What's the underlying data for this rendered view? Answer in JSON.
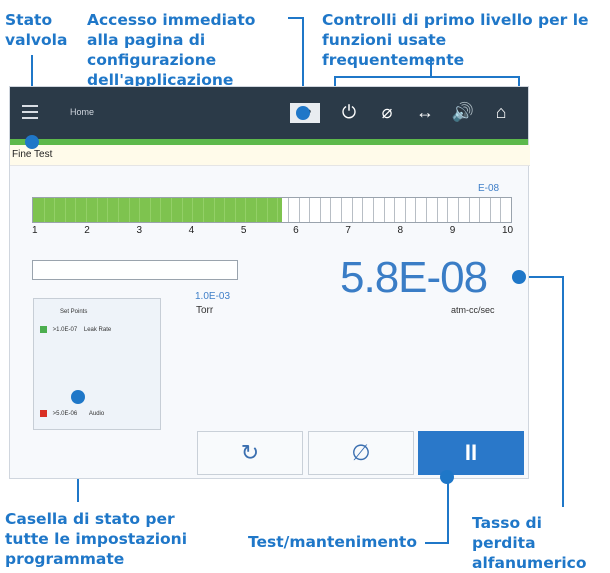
{
  "annotations": {
    "valve_state": "Stato valvola",
    "config_access": "Accesso immediato alla pagina di configurazione dell'applicazione",
    "top_controls": "Controlli di primo livello per le funzioni usate frequentemente",
    "status_box": "Casella di stato per tutte le impostazioni programmate",
    "test_hold": "Test/mantenimento",
    "leak_rate": "Tasso di perdita alfanumerico"
  },
  "topbar": {
    "home_label": "Home",
    "sp_label": "SP",
    "icons": [
      "power-icon",
      "null-icon",
      "exchange-icon",
      "volume-icon",
      "home-icon"
    ]
  },
  "statusbar": {
    "text": "Fine Test"
  },
  "bargraph": {
    "range_label": "E-08",
    "ticks": [
      "1",
      "2",
      "3",
      "4",
      "5",
      "6",
      "7",
      "8",
      "9",
      "10"
    ],
    "fill_fraction": 0.52,
    "colors": {
      "fill": "#7ec34f",
      "empty": "#ffffff"
    }
  },
  "pressure": {
    "value": "1.0E-03",
    "unit": "Torr"
  },
  "leak_rate": {
    "value": "5.8E-08",
    "unit": "atm-cc/sec"
  },
  "setpoints": {
    "title": "Set Points",
    "items": [
      {
        "value": ">1.0E-07",
        "label": "Leak Rate",
        "color": "#4cae4f"
      },
      {
        "value": ">5.0E-06",
        "label": "Audio",
        "color": "#d93025"
      }
    ]
  },
  "buttons": {
    "refresh_symbol": "↻",
    "zero_symbol": "∅",
    "pause_symbol": "II"
  }
}
